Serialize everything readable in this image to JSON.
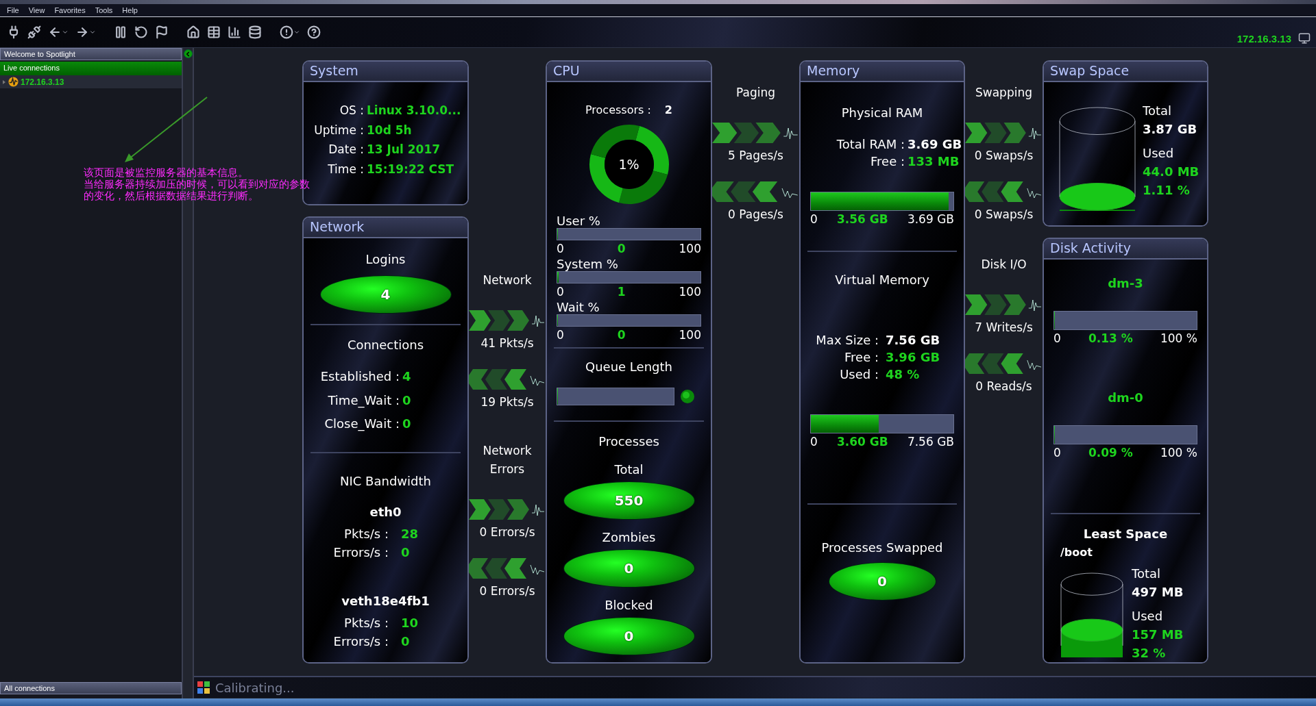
{
  "menu": [
    {
      "label": "File"
    },
    {
      "label": "View"
    },
    {
      "label": "Favorites"
    },
    {
      "label": "Tools"
    },
    {
      "label": "Help"
    }
  ],
  "host": "172.16.3.13",
  "sidebar": {
    "header": "Welcome to Spotlight",
    "section": "Live connections",
    "items": [
      {
        "label": "172.16.3.13"
      }
    ],
    "footer": "All connections"
  },
  "annotation": [
    "该页面是被监控服务器的基本信息。",
    "当给服务器持续加压的时候，可以看到对应的参数",
    "的变化，然后根据数据结果进行判断。"
  ],
  "system": {
    "title": "System",
    "fields": [
      {
        "label": "OS :",
        "value": "Linux 3.10.0...",
        "accent": true
      },
      {
        "label": "Uptime :",
        "value": "10d 5h",
        "accent": true
      },
      {
        "label": "Date :",
        "value": "13 Jul 2017",
        "accent": true
      },
      {
        "label": "Time :",
        "value": "15:19:22 CST",
        "accent": true
      }
    ]
  },
  "network": {
    "title": "Network",
    "logins": {
      "title": "Logins",
      "value": "4"
    },
    "connections": {
      "title": "Connections",
      "fields": [
        {
          "label": "Established :",
          "value": "4",
          "accent": true
        },
        {
          "label": "Time_Wait :",
          "value": "0",
          "accent": true
        },
        {
          "label": "Close_Wait :",
          "value": "0",
          "accent": true
        }
      ]
    },
    "nic": {
      "title": "NIC Bandwidth",
      "interfaces": [
        {
          "name": "eth0",
          "fields": [
            {
              "label": "Pkts/s :",
              "value": "28",
              "accent": true
            },
            {
              "label": "Errors/s :",
              "value": "0",
              "accent": true
            }
          ]
        },
        {
          "name": "veth18e4fb1",
          "fields": [
            {
              "label": "Pkts/s :",
              "value": "10",
              "accent": true
            },
            {
              "label": "Errors/s :",
              "value": "0",
              "accent": true
            }
          ]
        }
      ]
    }
  },
  "cpu": {
    "title": "CPU",
    "processors": {
      "label": "Processors :",
      "value": "2"
    },
    "load": "1%",
    "meters": [
      {
        "label": "User %",
        "min": "0",
        "reading": "0",
        "max": "100",
        "level": 0
      },
      {
        "label": "System %",
        "min": "0",
        "reading": "1",
        "max": "100",
        "level": 0.01
      },
      {
        "label": "Wait %",
        "min": "0",
        "reading": "0",
        "max": "100",
        "level": 0
      }
    ],
    "queue": {
      "title": "Queue Length",
      "level": 0
    },
    "processes": {
      "title": "Processes",
      "counters": [
        {
          "label": "Total",
          "value": "550"
        },
        {
          "label": "Zombies",
          "value": "0"
        },
        {
          "label": "Blocked",
          "value": "0"
        }
      ]
    }
  },
  "memory": {
    "title": "Memory",
    "sections": [
      {
        "title": "Physical RAM",
        "fields": [
          {
            "label": "Total RAM :",
            "value": "3.69 GB",
            "accent": false
          },
          {
            "label": "Free :",
            "value": "133 MB",
            "accent": true
          }
        ],
        "bar": {
          "min": "0",
          "reading": "3.56 GB",
          "max": "3.69 GB",
          "level": 0.965
        }
      },
      {
        "title": "Virtual Memory",
        "fields": [
          {
            "label": "Max Size :",
            "value": "7.56 GB",
            "accent": false
          },
          {
            "label": "Free :",
            "value": "3.96 GB",
            "accent": true
          },
          {
            "label": "Used :",
            "value": "48 %",
            "accent": true
          }
        ],
        "bar": {
          "min": "0",
          "reading": "3.60 GB",
          "max": "7.56 GB",
          "level": 0.476
        }
      }
    ],
    "swapped": {
      "title": "Processes Swapped",
      "value": "0"
    }
  },
  "swap": {
    "title": "Swap Space",
    "level": 0.0111,
    "stats": [
      {
        "text": "Total",
        "kind": "label"
      },
      {
        "text": "3.87 GB",
        "kind": "value"
      },
      {
        "text": "Used",
        "kind": "label"
      },
      {
        "text": "44.0 MB",
        "kind": "accent"
      },
      {
        "text": "1.11 %",
        "kind": "accent"
      }
    ]
  },
  "disk": {
    "title": "Disk Activity",
    "devices": [
      {
        "name": "dm-3",
        "min": "0",
        "reading": "0.13 %",
        "max": "100 %",
        "level": 0.0013
      },
      {
        "name": "dm-0",
        "min": "0",
        "reading": "0.09 %",
        "max": "100 %",
        "level": 0.0009
      }
    ],
    "least_space": {
      "title": "Least Space",
      "mount": "/boot",
      "level": 0.32,
      "stats": [
        {
          "text": "Total",
          "kind": "label"
        },
        {
          "text": "497 MB",
          "kind": "value"
        },
        {
          "text": "Used",
          "kind": "label"
        },
        {
          "text": "157 MB",
          "kind": "accent"
        },
        {
          "text": "32 %",
          "kind": "accent"
        }
      ]
    }
  },
  "flows": [
    {
      "groups": [
        {
          "title": "Network",
          "flows": [
            {
              "kind": "out",
              "reading": "41 Pkts/s"
            },
            {
              "kind": "in",
              "reading": "19 Pkts/s"
            }
          ]
        },
        {
          "title": "Network Errors",
          "flows": [
            {
              "kind": "out",
              "reading": "0 Errors/s"
            },
            {
              "kind": "in",
              "reading": "0 Errors/s"
            }
          ]
        }
      ]
    },
    {
      "groups": [
        {
          "title": "Paging",
          "flows": [
            {
              "kind": "out",
              "reading": "5 Pages/s"
            },
            {
              "kind": "in",
              "reading": "0 Pages/s"
            }
          ]
        }
      ]
    },
    {
      "groups": [
        {
          "title": "Swapping",
          "flows": [
            {
              "kind": "out",
              "reading": "0 Swaps/s"
            },
            {
              "kind": "in",
              "reading": "0 Swaps/s"
            }
          ]
        },
        {
          "title": "Disk I/O",
          "flows": [
            {
              "kind": "out",
              "reading": "7 Writes/s"
            },
            {
              "kind": "in",
              "reading": "0 Reads/s"
            }
          ]
        }
      ]
    }
  ],
  "status": "Calibrating..."
}
